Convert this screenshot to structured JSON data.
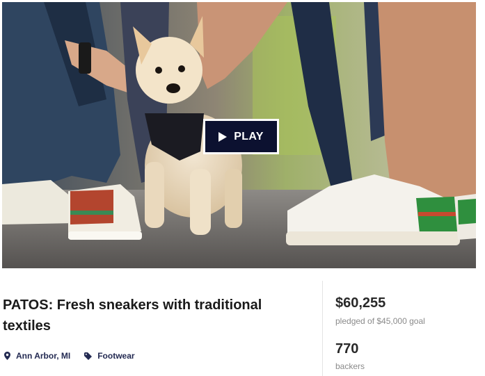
{
  "video": {
    "play_label": "PLAY",
    "play_icon": "play-triangle-icon"
  },
  "project": {
    "title": "PATOS: Fresh sneakers with traditional textiles",
    "location": "Ann Arbor, MI",
    "location_icon": "map-pin-icon",
    "category": "Footwear",
    "category_icon": "tag-icon"
  },
  "stats": {
    "pledged_amount": "$60,255",
    "pledged_label": "pledged of $45,000 goal",
    "backers_count": "770",
    "backers_label": "backers"
  },
  "colors": {
    "play_button_bg": "#0c1130",
    "link_color": "#232a52",
    "muted_text": "#8a8a8a"
  }
}
